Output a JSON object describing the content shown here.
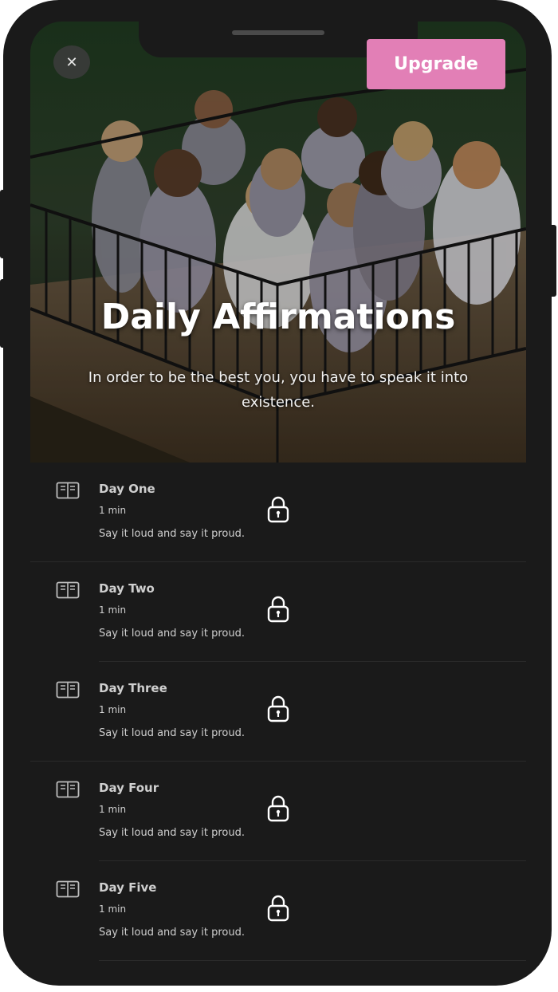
{
  "header": {
    "close_symbol": "✕",
    "upgrade_label": "Upgrade"
  },
  "hero": {
    "title": "Daily Affirmations",
    "subtitle": "In order to be the best you, you have to speak it into existence."
  },
  "colors": {
    "background": "#1a1a1a",
    "accent": "#e27fb6",
    "text": "#cfcfcf"
  },
  "lessons": [
    {
      "title": "Day One",
      "duration": "1 min",
      "description": "Say it loud and say it proud.",
      "icon": "book-icon",
      "status_icon": "lock-icon"
    },
    {
      "title": "Day Two",
      "duration": "1 min",
      "description": "Say it loud and say it proud.",
      "icon": "book-icon",
      "status_icon": "lock-icon"
    },
    {
      "title": "Day Three",
      "duration": "1 min",
      "description": "Say it loud and say it proud.",
      "icon": "book-icon",
      "status_icon": "lock-icon"
    },
    {
      "title": "Day Four",
      "duration": "1 min",
      "description": "Say it loud and say it proud.",
      "icon": "book-icon",
      "status_icon": "lock-icon"
    },
    {
      "title": "Day Five",
      "duration": "1 min",
      "description": "Say it loud and say it proud.",
      "icon": "book-icon",
      "status_icon": "lock-icon"
    }
  ]
}
